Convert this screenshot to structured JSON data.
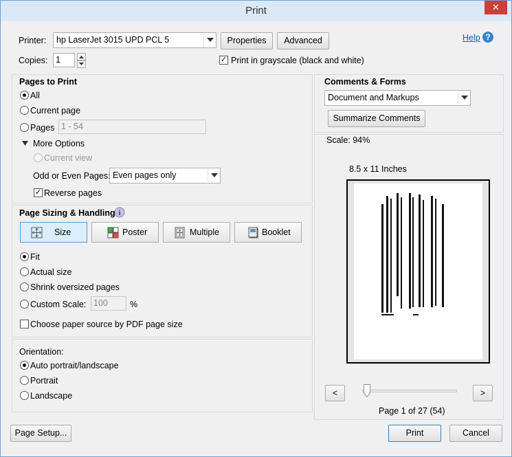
{
  "window": {
    "title": "Print",
    "close": "✕"
  },
  "header": {
    "printer_label": "Printer:",
    "printer_value": "hp LaserJet 3015 UPD PCL 5",
    "properties": "Properties",
    "advanced": "Advanced",
    "help": "Help",
    "copies_label": "Copies:",
    "copies_value": "1",
    "grayscale": "Print in grayscale (black and white)"
  },
  "pages": {
    "title": "Pages to Print",
    "all": "All",
    "current_page": "Current page",
    "pages": "Pages",
    "pages_range": "1 - 54",
    "more_options": "More Options",
    "current_view": "Current view",
    "odd_even_label": "Odd or Even Pages:",
    "odd_even_value": "Even pages only",
    "reverse": "Reverse pages"
  },
  "sizing": {
    "title": "Page Sizing & Handling",
    "size": "Size",
    "poster": "Poster",
    "multiple": "Multiple",
    "booklet": "Booklet",
    "fit": "Fit",
    "actual": "Actual size",
    "shrink": "Shrink oversized pages",
    "custom": "Custom Scale:",
    "custom_value": "100",
    "percent": "%",
    "paper_source": "Choose paper source by PDF page size"
  },
  "orientation": {
    "title": "Orientation:",
    "auto": "Auto portrait/landscape",
    "portrait": "Portrait",
    "landscape": "Landscape"
  },
  "comments": {
    "title": "Comments & Forms",
    "value": "Document and Markups",
    "summarize": "Summarize Comments"
  },
  "preview": {
    "scale": "Scale:  94%",
    "paper": "8.5 x 11 Inches",
    "prev": "<",
    "next": ">",
    "page_info": "Page 1 of 27 (54)",
    "slider_fraction": 0.03
  },
  "footer": {
    "page_setup": "Page Setup...",
    "print": "Print",
    "cancel": "Cancel"
  }
}
